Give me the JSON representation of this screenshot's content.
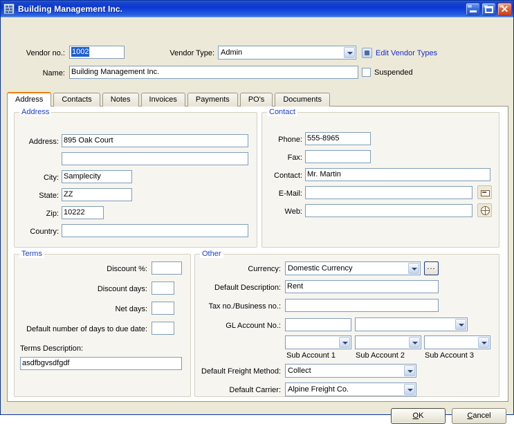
{
  "window": {
    "title": "Building Management Inc.",
    "icon": "window-grid-icon",
    "buttons": {
      "minimize": "minimize-icon",
      "maximize": "maximize-icon",
      "close": "✕"
    }
  },
  "header": {
    "vendor_no_label": "Vendor no.:",
    "vendor_no_value": "1002",
    "vendor_no_selected": true,
    "vendor_type_label": "Vendor Type:",
    "vendor_type_value": "Admin",
    "edit_vendor_types_link": "Edit Vendor Types",
    "name_label": "Name:",
    "name_value": "Building Management Inc.",
    "suspended_label": "Suspended",
    "suspended_checked": false
  },
  "tabs": [
    {
      "label": "Address",
      "active": true
    },
    {
      "label": "Contacts",
      "active": false
    },
    {
      "label": "Notes",
      "active": false
    },
    {
      "label": "Invoices",
      "active": false
    },
    {
      "label": "Payments",
      "active": false
    },
    {
      "label": "PO's",
      "active": false
    },
    {
      "label": "Documents",
      "active": false
    }
  ],
  "address_group": {
    "legend": "Address",
    "address_label": "Address:",
    "address_line1": "895 Oak Court",
    "address_line2": "",
    "city_label": "City:",
    "city": "Samplecity",
    "state_label": "State:",
    "state": "ZZ",
    "zip_label": "Zip:",
    "zip": "10222",
    "country_label": "Country:",
    "country": ""
  },
  "contact_group": {
    "legend": "Contact",
    "phone_label": "Phone:",
    "phone": "555-8965",
    "fax_label": "Fax:",
    "fax": "",
    "contact_label": "Contact:",
    "contact": "Mr. Martin",
    "email_label": "E-Mail:",
    "email": "",
    "email_button_icon": "envelope-icon",
    "web_label": "Web:",
    "web": "",
    "web_button_icon": "globe-icon"
  },
  "terms_group": {
    "legend": "Terms",
    "discount_pct_label": "Discount %:",
    "discount_pct": "",
    "discount_days_label": "Discount days:",
    "discount_days": "",
    "net_days_label": "Net days:",
    "net_days": "",
    "default_days_label": "Default number of days to due date:",
    "default_days": "",
    "terms_description_label": "Terms Description:",
    "terms_description": "asdfbgvsdfgdf"
  },
  "other_group": {
    "legend": "Other",
    "currency_label": "Currency:",
    "currency": "Domestic Currency",
    "currency_browse_button": "...",
    "default_description_label": "Default Description:",
    "default_description": "Rent",
    "tax_no_label": "Tax no./Business no.:",
    "tax_no": "",
    "gl_account_label": "GL Account No.:",
    "gl_account_no": "",
    "gl_account_name": "",
    "sub_account_1": "",
    "sub_account_2": "",
    "sub_account_3": "",
    "sub_account_1_caption": "Sub Account 1",
    "sub_account_2_caption": "Sub Account 2",
    "sub_account_3_caption": "Sub Account 3",
    "freight_method_label": "Default Freight Method:",
    "freight_method": "Collect",
    "carrier_label": "Default Carrier:",
    "carrier": "Alpine Freight Co."
  },
  "footer": {
    "ok_label": "OK",
    "ok_accel": "O",
    "cancel_label": "Cancel",
    "cancel_accel": "C"
  },
  "colors": {
    "titlebar": "#0a36d6",
    "dialog": "#ece9d8",
    "accent_tab": "#e8820c",
    "link": "#1a2ecb",
    "legend": "#1a3fc4",
    "field_border": "#7f9db9",
    "selection": "#1c5fd0"
  }
}
